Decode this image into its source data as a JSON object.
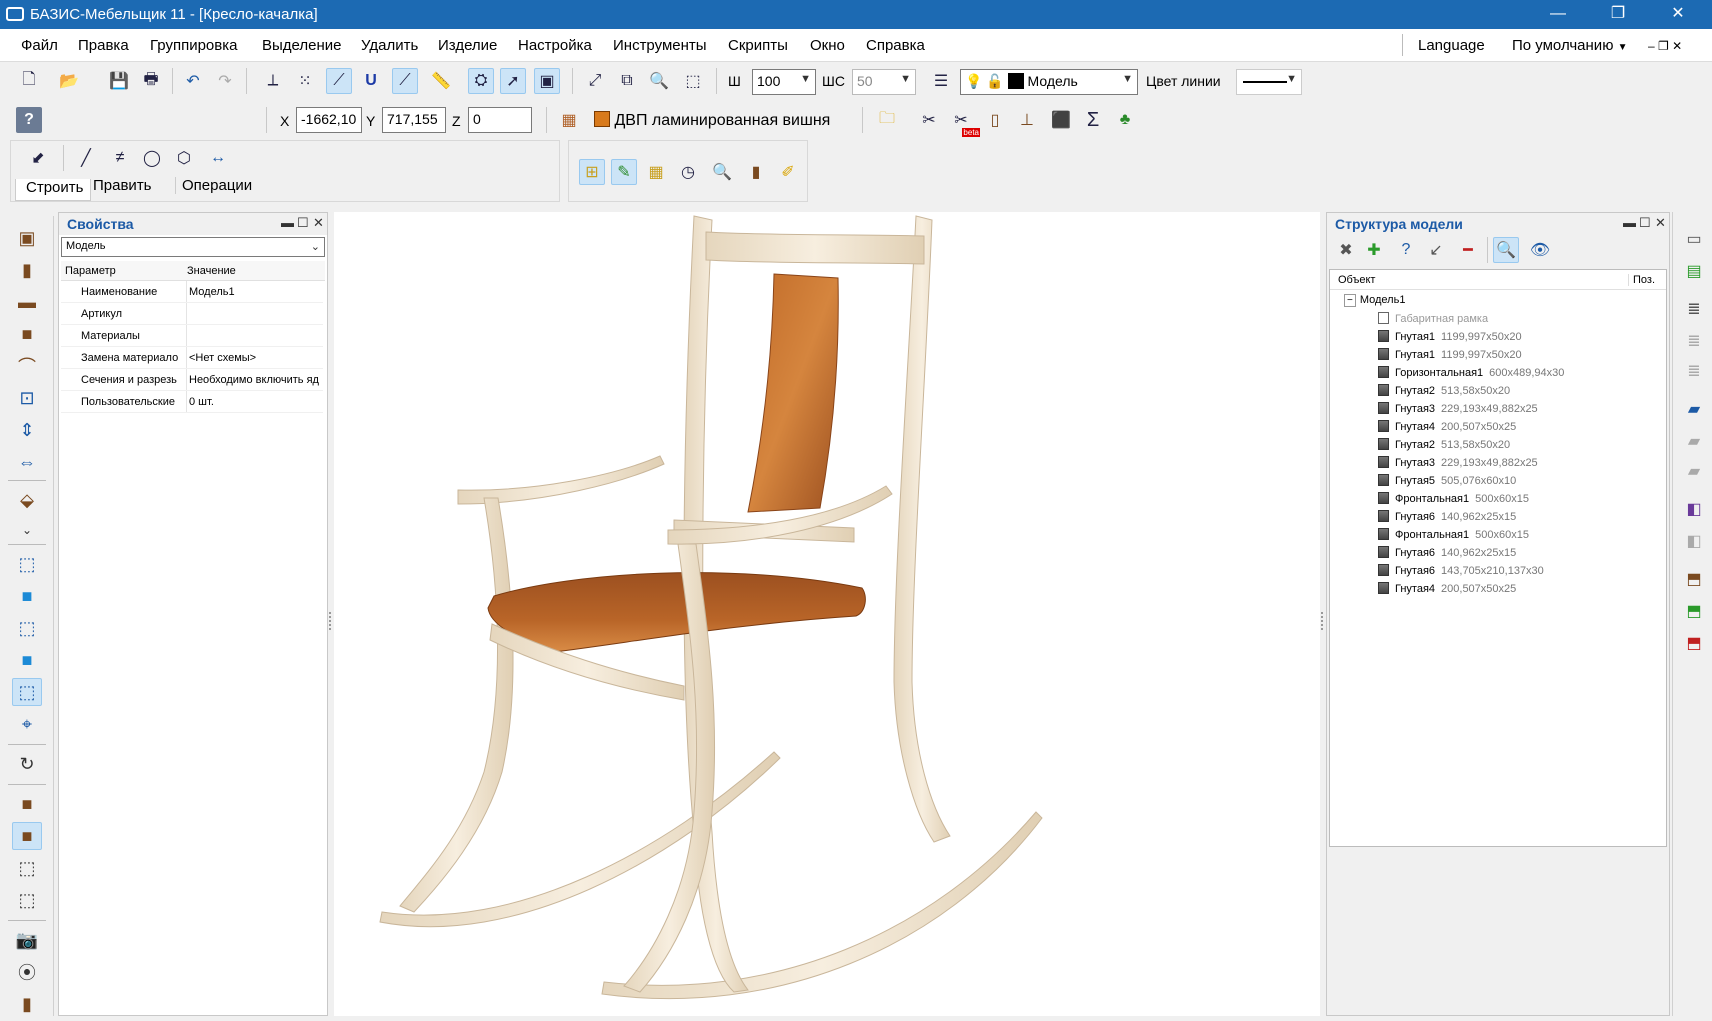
{
  "window": {
    "title": "БАЗИС-Мебельщик 11 - [Кресло-качалка]",
    "minimize": "—",
    "maximize": "❐",
    "close": "✕"
  },
  "menu": {
    "items": [
      "Файл",
      "Правка",
      "Группировка",
      "Выделение",
      "Удалить",
      "Изделие",
      "Настройка",
      "Инструменты",
      "Скрипты",
      "Окно",
      "Справка"
    ],
    "language": "Language",
    "profile": "По умолчанию"
  },
  "toolbar": {
    "w_label": "Ш",
    "w_value": "100",
    "ws_label": "ШС",
    "ws_value": "50",
    "layer": "Модель",
    "line_color_label": "Цвет линии"
  },
  "coords": {
    "x_label": "X",
    "x_value": "-1662,10",
    "y_label": "Y",
    "y_value": "717,155",
    "z_label": "Z",
    "z_value": "0",
    "material": "ДВП ламинированная вишня",
    "beta_badge": "beta"
  },
  "build_tabs": [
    "Строить",
    "Править",
    "Операции"
  ],
  "properties": {
    "title": "Свойства",
    "selector": "Модель",
    "col_param": "Параметр",
    "col_value": "Значение",
    "rows": [
      {
        "k": "Наименование",
        "v": "Модель1"
      },
      {
        "k": "Артикул",
        "v": ""
      },
      {
        "k": "Материалы",
        "v": ""
      },
      {
        "k": "Замена материало",
        "v": "<Нет схемы>"
      },
      {
        "k": "Сечения и разрезь",
        "v": "Необходимо включить яд"
      },
      {
        "k": "Пользовательские",
        "v": "0 шт."
      }
    ]
  },
  "structure": {
    "title": "Структура модели",
    "col_object": "Объект",
    "col_pos": "Поз.",
    "root": "Модель1",
    "frame": "Габаритная рамка",
    "items": [
      {
        "n": "Гнутая1",
        "d": "1199,997x50x20"
      },
      {
        "n": "Гнутая1",
        "d": "1199,997x50x20"
      },
      {
        "n": "Горизонтальная1",
        "d": "600x489,94x30"
      },
      {
        "n": "Гнутая2",
        "d": "513,58x50x20"
      },
      {
        "n": "Гнутая3",
        "d": "229,193x49,882x25"
      },
      {
        "n": "Гнутая4",
        "d": "200,507x50x25"
      },
      {
        "n": "Гнутая2",
        "d": "513,58x50x20"
      },
      {
        "n": "Гнутая3",
        "d": "229,193x49,882x25"
      },
      {
        "n": "Гнутая5",
        "d": "505,076x60x10"
      },
      {
        "n": "Фронтальная1",
        "d": "500x60x15"
      },
      {
        "n": "Гнутая6",
        "d": "140,962x25x15"
      },
      {
        "n": "Фронтальная1",
        "d": "500x60x15"
      },
      {
        "n": "Гнутая6",
        "d": "140,962x25x15"
      },
      {
        "n": "Гнутая6",
        "d": "143,705x210,137x30"
      },
      {
        "n": "Гнутая4",
        "d": "200,507x50x25"
      }
    ]
  },
  "colors": {
    "titlebar": "#1c6ab3",
    "wood_light": "#f1e6d2",
    "cherry": "#b0622a",
    "panel_title": "#1c5aa6"
  }
}
